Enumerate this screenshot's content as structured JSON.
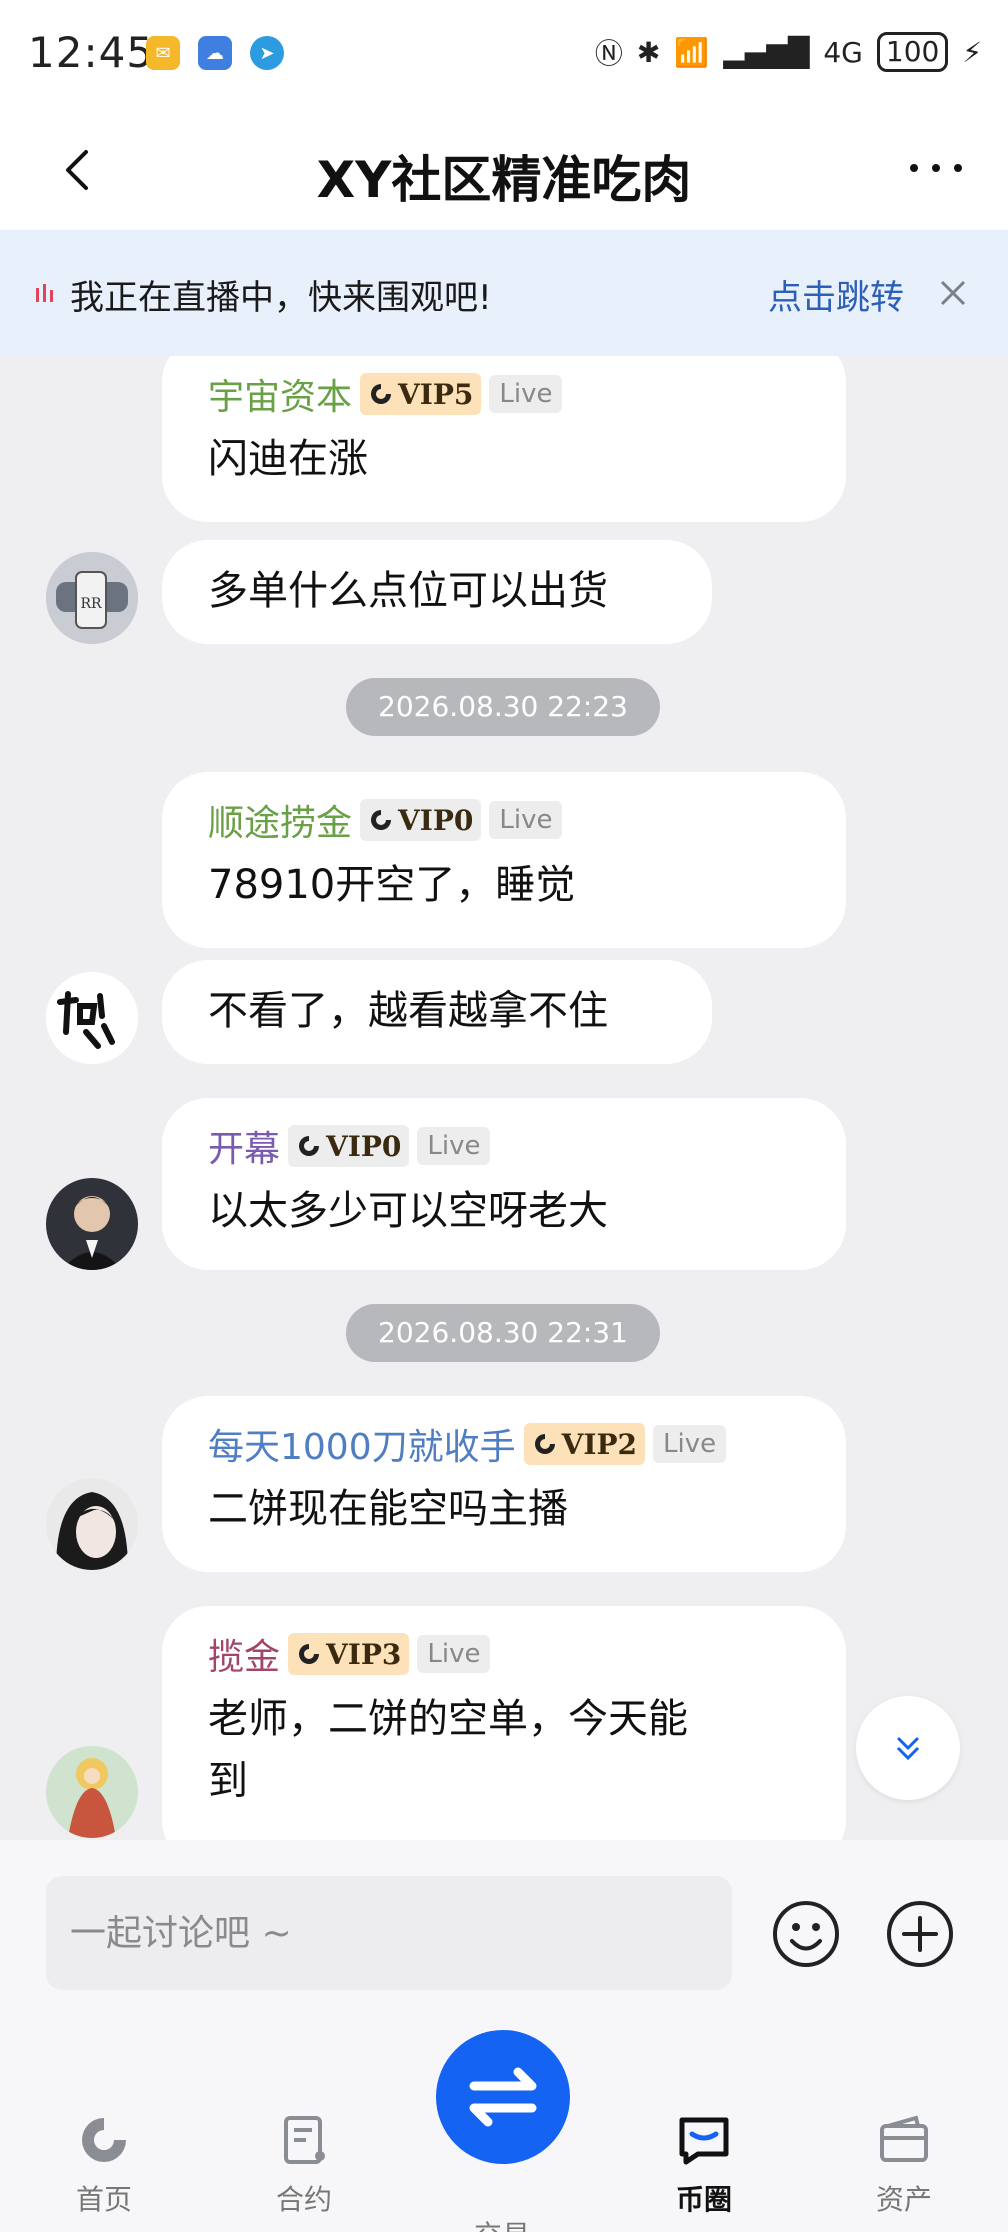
{
  "status": {
    "time": "12:45",
    "network": "4G",
    "battery": "100"
  },
  "header": {
    "title": "XY社区精准吃肉"
  },
  "live_banner": {
    "text": "我正在直播中，快来围观吧!",
    "link": "点击跳转"
  },
  "messages": [
    {
      "sender": "宇宙资本",
      "sender_color": "#6aa046",
      "vip": "VIP5",
      "live": "Live",
      "lines": [
        "闪迪在涨",
        "多单什么点位可以出货"
      ]
    },
    {
      "timestamp": "2026.08.30 22:23"
    },
    {
      "sender": "顺途捞金",
      "sender_color": "#6aa046",
      "vip": "VIP0",
      "live": "Live",
      "lines": [
        "78910开空了，睡觉",
        "不看了，越看越拿不住"
      ]
    },
    {
      "sender": "开幕",
      "sender_color": "#7b5bb0",
      "vip": "VIP0",
      "live": "Live",
      "lines": [
        "以太多少可以空呀老大"
      ]
    },
    {
      "timestamp": "2026.08.30 22:31"
    },
    {
      "sender": "每天1000刀就收手",
      "sender_color": "#4f7fc2",
      "vip": "VIP2",
      "live": "Live",
      "lines": [
        "二饼现在能空吗主播"
      ]
    },
    {
      "sender": "揽金",
      "sender_color": "#a1456a",
      "vip": "VIP3",
      "live": "Live",
      "lines": [
        "老师，二饼的空单，今天能",
        "到"
      ]
    }
  ],
  "input": {
    "placeholder": "一起讨论吧 ~"
  },
  "nav": {
    "items": [
      "首页",
      "合约",
      "交易",
      "币圈",
      "资产"
    ],
    "active": "币圈"
  },
  "colors": {
    "accent": "#1463f2",
    "banner_bg": "#e8f0fb",
    "link": "#2c5fb8"
  }
}
